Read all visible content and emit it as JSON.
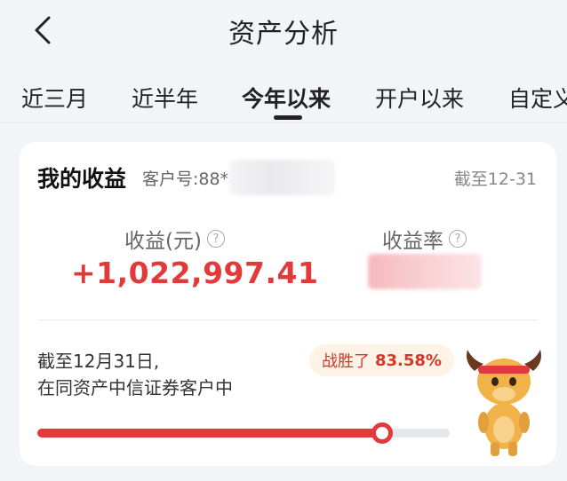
{
  "header": {
    "title": "资产分析",
    "back_icon": "chevron-left-icon"
  },
  "tabs": [
    {
      "label": "近三月",
      "active": false
    },
    {
      "label": "近半年",
      "active": false
    },
    {
      "label": "今年以来",
      "active": true
    },
    {
      "label": "开户以来",
      "active": false
    },
    {
      "label": "自定义",
      "active": false
    }
  ],
  "card": {
    "title": "我的收益",
    "client_id": "客户号:88*",
    "as_of": "截至12-31",
    "profit": {
      "label": "收益(元)",
      "value": "+1,022,997.41"
    },
    "rate": {
      "label": "收益率"
    },
    "ranking": {
      "line1": "截至12月31日,",
      "line2": "在同资产中信证券客户中",
      "bubble_prefix": "战胜了",
      "bubble_value": "83.58%",
      "percentile": 0.8358
    }
  },
  "colors": {
    "accent": "#e23a3a",
    "background": "#f3f4f8",
    "bubble_bg": "#fff2e6"
  }
}
